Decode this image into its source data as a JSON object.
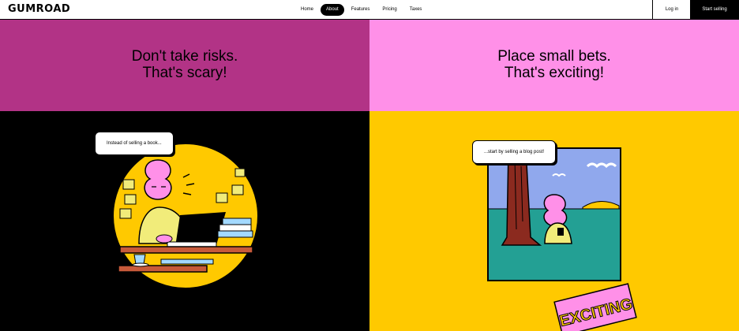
{
  "header": {
    "logo": "GUMROAD",
    "nav": [
      {
        "label": "Home",
        "active": false
      },
      {
        "label": "About",
        "active": true
      },
      {
        "label": "Features",
        "active": false
      },
      {
        "label": "Pricing",
        "active": false
      },
      {
        "label": "Taxes",
        "active": false
      }
    ],
    "login_label": "Log in",
    "start_label": "Start selling"
  },
  "left": {
    "headline_line1": "Don't take risks.",
    "headline_line2": "That's scary!",
    "bubble": "Instead of selling a book..."
  },
  "right": {
    "headline_line1": "Place small bets.",
    "headline_line2": "That's exciting!",
    "bubble": "...start by selling a blog post!",
    "sticker": "EXCITING"
  },
  "colors": {
    "magenta": "#b23386",
    "pink": "#ff90e8",
    "yellow": "#ffc900",
    "black": "#000000"
  }
}
